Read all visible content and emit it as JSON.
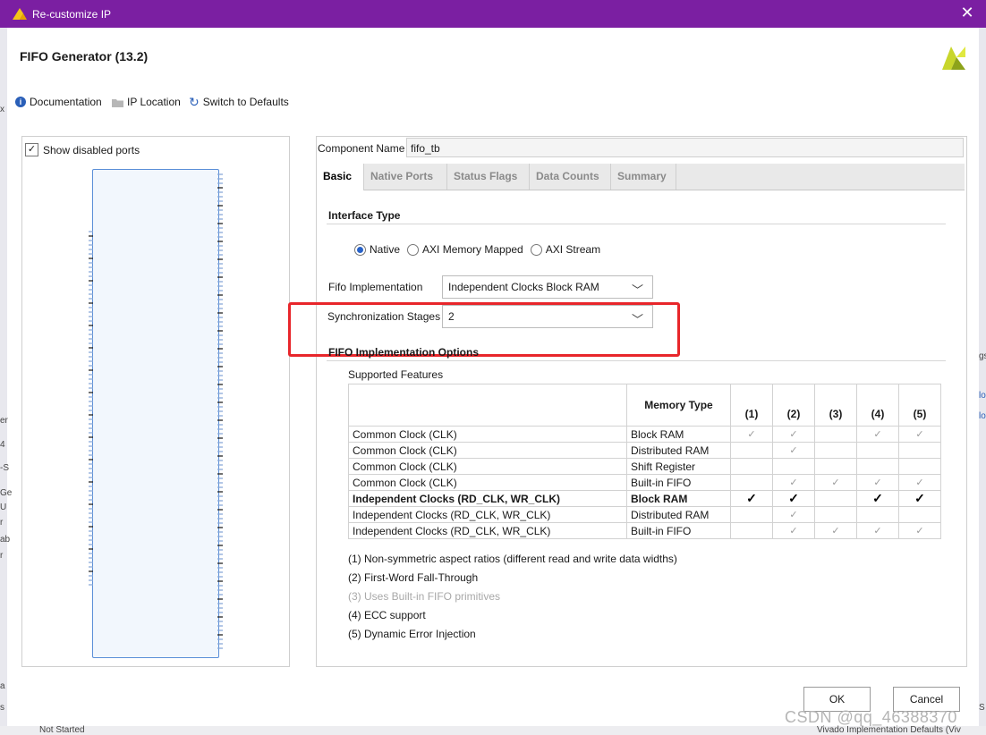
{
  "window": {
    "title": "Re-customize IP"
  },
  "header": {
    "title": "FIFO Generator (13.2)"
  },
  "toolbar": {
    "documentation": "Documentation",
    "ip_location": "IP Location",
    "switch_defaults": "Switch to Defaults"
  },
  "left_panel": {
    "show_disabled_ports": "Show disabled ports"
  },
  "component": {
    "label": "Component Name",
    "value": "fifo_tb"
  },
  "tabs": [
    {
      "label": "Basic"
    },
    {
      "label": "Native Ports"
    },
    {
      "label": "Status Flags"
    },
    {
      "label": "Data Counts"
    },
    {
      "label": "Summary"
    }
  ],
  "interface_type": {
    "title": "Interface Type",
    "options": [
      "Native",
      "AXI Memory Mapped",
      "AXI Stream"
    ],
    "selected": "Native"
  },
  "fifo_impl": {
    "label": "Fifo Implementation",
    "value": "Independent Clocks Block RAM"
  },
  "sync_stages": {
    "label": "Synchronization Stages",
    "value": "2"
  },
  "impl_options": {
    "title": "FIFO Implementation Options",
    "supported": "Supported Features",
    "memory_header": "Memory Type",
    "columns": [
      "(1)",
      "(2)",
      "(3)",
      "(4)",
      "(5)"
    ],
    "rows": [
      {
        "clock": "Common Clock (CLK)",
        "mem": "Block RAM"
      },
      {
        "clock": "Common Clock (CLK)",
        "mem": "Distributed RAM"
      },
      {
        "clock": "Common Clock (CLK)",
        "mem": "Shift Register"
      },
      {
        "clock": "Common Clock (CLK)",
        "mem": "Built-in FIFO"
      },
      {
        "clock": "Independent Clocks (RD_CLK, WR_CLK)",
        "mem": "Block RAM"
      },
      {
        "clock": "Independent Clocks (RD_CLK, WR_CLK)",
        "mem": "Distributed RAM"
      },
      {
        "clock": "Independent Clocks (RD_CLK, WR_CLK)",
        "mem": "Built-in FIFO"
      }
    ],
    "check": "✓",
    "notes": [
      "(1) Non-symmetric aspect ratios (different read and write data widths)",
      "(2) First-Word Fall-Through",
      "(3) Uses Built-in FIFO primitives",
      "(4) ECC support",
      "(5) Dynamic Error Injection"
    ]
  },
  "buttons": {
    "ok": "OK",
    "cancel": "Cancel"
  },
  "watermark": "CSDN @qq_46388370",
  "background": {
    "left_frags": [
      "x",
      "er",
      "4",
      "-S",
      "Ge",
      "U",
      "r",
      "ab",
      "r",
      "a",
      "s"
    ],
    "right_frags": [
      "gs",
      "lo",
      "lo",
      "S"
    ],
    "bottom_left": "Not Started",
    "bottom_right": "Vivado Implementation Defaults (Viv"
  },
  "colors": {
    "titlebar": "#7b1fa2",
    "highlight": "#e8262b",
    "symbol_border": "#5b8fd8"
  }
}
